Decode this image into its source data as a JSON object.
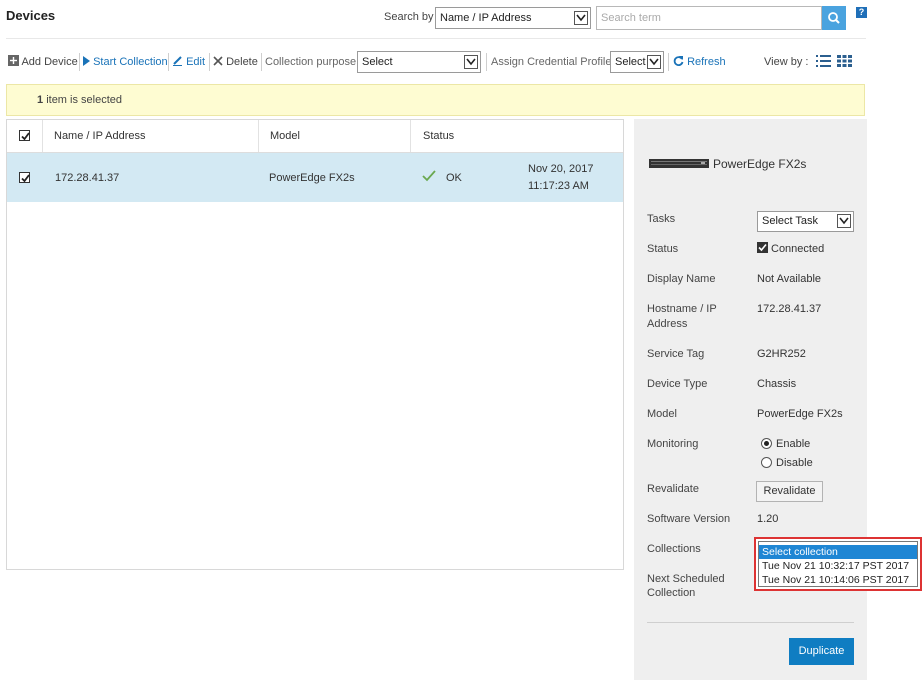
{
  "header": {
    "title": "Devices",
    "search_by_label": "Search by",
    "search_by_value": "Name / IP Address",
    "search_placeholder": "Search term",
    "help_label": "?"
  },
  "toolbar": {
    "add_device": "Add Device",
    "start_collection": "Start Collection",
    "edit": "Edit",
    "delete": "Delete",
    "collection_purpose_label": "Collection purpose",
    "collection_purpose_value": "Select",
    "assign_profile_label": "Assign Credential Profile",
    "assign_profile_value": "Select",
    "refresh": "Refresh",
    "view_by_label": "View by :"
  },
  "banner": {
    "count": "1",
    "text": "item is selected"
  },
  "grid": {
    "columns": [
      "Name / IP Address",
      "Model",
      "Status"
    ],
    "rows": [
      {
        "ip": "172.28.41.37",
        "model": "PowerEdge FX2s",
        "status": "OK",
        "date": "Nov 20, 2017",
        "time": "11:17:23 AM",
        "checked": true
      }
    ]
  },
  "details": {
    "device_name": "PowerEdge FX2s",
    "tasks_label": "Tasks",
    "tasks_value": "Select Task",
    "status_label": "Status",
    "status_value": "Connected",
    "display_name_label": "Display Name",
    "display_name_value": "Not Available",
    "hostname_label_1": "Hostname / IP",
    "hostname_label_2": "Address",
    "hostname_value": "172.28.41.37",
    "service_tag_label": "Service Tag",
    "service_tag_value": "G2HR252",
    "device_type_label": "Device Type",
    "device_type_value": "Chassis",
    "model_label": "Model",
    "model_value": "PowerEdge FX2s",
    "monitoring_label": "Monitoring",
    "monitoring_enable": "Enable",
    "monitoring_disable": "Disable",
    "revalidate_label": "Revalidate",
    "revalidate_button": "Revalidate",
    "software_version_label": "Software Version",
    "software_version_value": "1.20",
    "collections_label": "Collections",
    "collections_options": [
      "Select collection",
      "Tue Nov 21 10:32:17 PST 2017",
      "Tue Nov 21 10:14:06 PST 2017"
    ],
    "next_scheduled_label_1": "Next Scheduled",
    "next_scheduled_label_2": "Collection",
    "duplicate_button": "Duplicate"
  },
  "colors": {
    "accent": "#1a73b8",
    "selected_row": "#d3e9f3",
    "banner": "#fefcd2",
    "primary_button": "#0f7dc2",
    "ok_check": "#6aa84f",
    "highlight_border": "#dd3333"
  }
}
